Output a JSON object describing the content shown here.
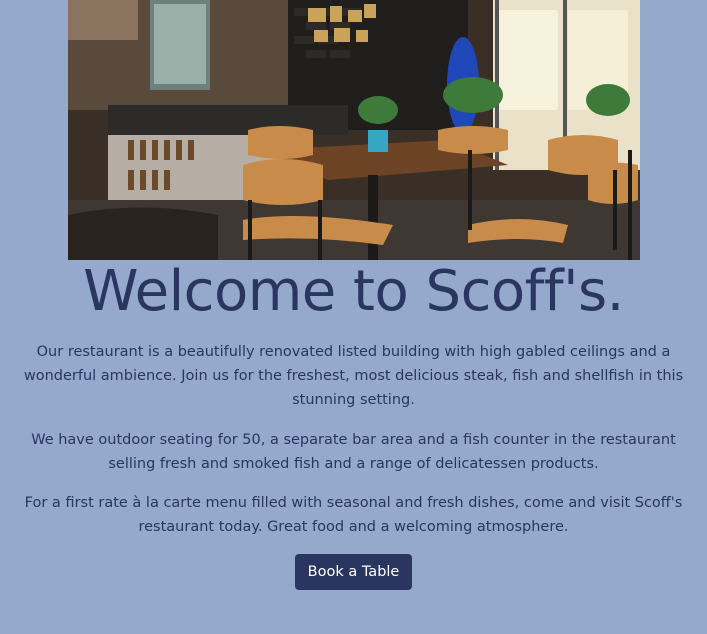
{
  "hero": {
    "image_alt": "Restaurant interior",
    "alt_description_visible": false
  },
  "heading": {
    "title": "Welcome to Scoff's."
  },
  "content": {
    "paragraphs": [
      "Our restaurant is a beautifully renovated listed building with high gabled ceilings and a wonderful ambience. Join us for the freshest, most delicious steak, fish and shellfish in this stunning setting.",
      "We have outdoor seating for 50, a separate bar area and a fish counter in the restaurant selling fresh and smoked fish and a range of delicatessen products.",
      "For a first rate à la carte menu filled with seasonal and fresh dishes, come and visit Scoff's restaurant today. Great food and a welcoming atmosphere."
    ]
  },
  "cta": {
    "label": "Book a Table"
  },
  "colors": {
    "background": "#94a9cc",
    "text": "#2a3560",
    "button_bg": "#2a3560",
    "button_text": "#ffffff"
  }
}
